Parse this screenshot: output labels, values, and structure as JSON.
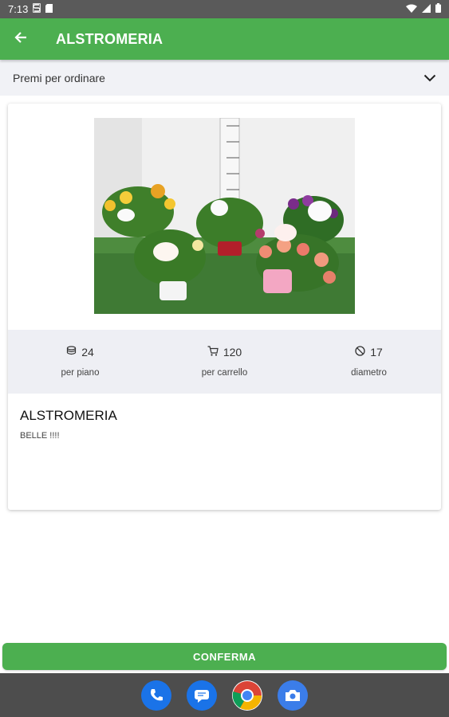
{
  "status_bar": {
    "time": "7:13",
    "icons": [
      "notification-s-icon",
      "sd-card-icon",
      "wifi-icon",
      "signal-icon",
      "battery-icon"
    ]
  },
  "app_bar": {
    "title": "ALSTROMERIA",
    "back_icon": "back-arrow-icon",
    "color": "#4caf50"
  },
  "order_dropdown": {
    "label": "Premi per ordinare",
    "icon": "chevron-down-icon"
  },
  "product": {
    "name": "ALSTROMERIA",
    "description": "BELLE !!!!",
    "image": "potted-flowers-photo",
    "stats": [
      {
        "icon": "layers-icon",
        "value": "24",
        "label": "per piano"
      },
      {
        "icon": "cart-icon",
        "value": "120",
        "label": "per carrello"
      },
      {
        "icon": "diameter-icon",
        "value": "17",
        "label": "diametro"
      }
    ]
  },
  "confirm_button": {
    "label": "CONFERMA"
  },
  "dock": {
    "apps": [
      "phone-app-icon",
      "messages-app-icon",
      "chrome-app-icon",
      "camera-app-icon"
    ]
  }
}
